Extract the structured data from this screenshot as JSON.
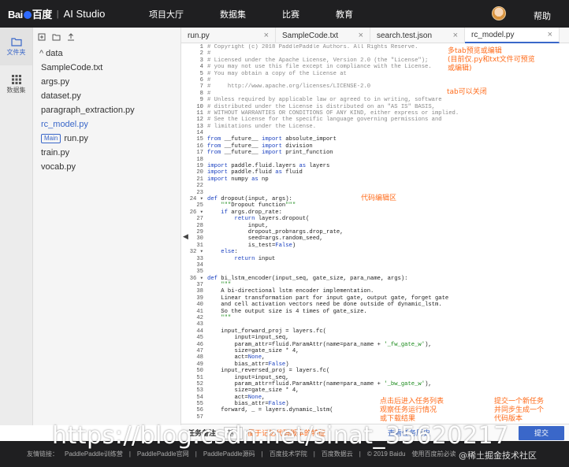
{
  "header": {
    "logo_text": "Bai百度",
    "title": "AI Studio",
    "nav": [
      "项目大厅",
      "数据集",
      "比赛",
      "教育"
    ],
    "help": "帮助"
  },
  "rail": {
    "items": [
      {
        "label": "文件夹",
        "icon": "folder-icon"
      },
      {
        "label": "数据集",
        "icon": "dataset-grid-icon"
      }
    ]
  },
  "filetree": {
    "folder": "data",
    "files": [
      "SampleCode.txt",
      "args.py",
      "dataset.py",
      "paragraph_extraction.py",
      "rc_model.py",
      "run.py",
      "train.py",
      "vocab.py"
    ],
    "main_badge": "Main",
    "selected": "rc_model.py"
  },
  "tabs": [
    {
      "label": "run.py"
    },
    {
      "label": "SampleCode.txt"
    },
    {
      "label": "search.test.json"
    },
    {
      "label": "rc_model.py"
    }
  ],
  "code": {
    "line_numbers": [
      "1",
      "2",
      "3",
      "4",
      "5",
      "6",
      "7",
      "8",
      "9",
      "10",
      "11",
      "12",
      "13",
      "14",
      "15",
      "16",
      "17",
      "18",
      "19",
      "20",
      "21",
      "22",
      "23",
      "24 ▾",
      "25",
      "26 ▾",
      "27",
      "28",
      "29",
      "30",
      "31",
      "32 ▾",
      "33",
      "34",
      "35",
      "36 ▾",
      "37",
      "38",
      "39",
      "40",
      "41",
      "42",
      "43",
      "44",
      "45",
      "46",
      "47",
      "48",
      "49",
      "50",
      "51",
      "52",
      "53",
      "54",
      "55",
      "56",
      "57"
    ],
    "lines": [
      "# Copyright (c) 2018 PaddlePaddle Authors. All Rights Reserve.",
      "#",
      "# Licensed under the Apache License, Version 2.0 (the \"License\");",
      "# you may not use this file except in compliance with the License.",
      "# You may obtain a copy of the License at",
      "#",
      "#     http://www.apache.org/licenses/LICENSE-2.0",
      "#",
      "# Unless required by applicable law or agreed to in writing, software",
      "# distributed under the License is distributed on an \"AS IS\" BASIS,",
      "# WITHOUT WARRANTIES OR CONDITIONS OF ANY KIND, either express or implied.",
      "# See the License for the specific language governing permissions and",
      "# limitations under the License.",
      "",
      "from __future__ import absolute_import",
      "from __future__ import division",
      "from __future__ import print_function",
      "",
      "import paddle.fluid.layers as layers",
      "import paddle.fluid as fluid",
      "import numpy as np",
      "",
      "",
      "def dropout(input, args):",
      "    \"\"\"Dropout function\"\"\"",
      "    if args.drop_rate:",
      "        return layers.dropout(",
      "            input,",
      "            dropout_prob=args.drop_rate,",
      "            seed=args.random_seed,",
      "            is_test=False)",
      "    else:",
      "        return input",
      "",
      "",
      "def bi_lstm_encoder(input_seq, gate_size, para_name, args):",
      "    \"\"\"",
      "    A bi-directional lstm encoder implementation.",
      "    Linear transformation part for input gate, output gate, forget gate",
      "    and cell activation vectors need be done outside of dynamic_lstm.",
      "    So the output size is 4 times of gate_size.",
      "    \"\"\"",
      "",
      "    input_forward_proj = layers.fc(",
      "        input=input_seq,",
      "        param_attr=fluid.ParamAttr(name=para_name + '_fw_gate_w'),",
      "        size=gate_size * 4,",
      "        act=None,",
      "        bias_attr=False)",
      "    input_reversed_proj = layers.fc(",
      "        input=input_seq,",
      "        param_attr=fluid.ParamAttr(name=para_name + '_bw_gate_w'),",
      "        size=gate_size * 4,",
      "        act=None,",
      "        bias_attr=False)",
      "    forward, _ = layers.dynamic_lstm(",
      ""
    ]
  },
  "annotations": {
    "tabs_note": [
      "多tab预览或编辑",
      "(目前仅.py和txt文件可预览",
      "或编辑)"
    ],
    "close_note": "tab可以关闭",
    "editor_note": "代码编辑区",
    "history_note": [
      "点击后进入任务列表",
      "观察任务运行情况",
      "或下载结果"
    ],
    "submit_note": [
      "提交一个新任务",
      "并同步生成一个",
      "代码版本"
    ]
  },
  "bottombar": {
    "label": "任务备注",
    "input_value": "基线",
    "hint": "便于记忆代码版本的特征",
    "history": "查看任务历史",
    "submit": "提交"
  },
  "footer": {
    "items": [
      "友情链接：",
      "PaddlePaddle训练营",
      "PaddlePaddle官网",
      "PaddlePaddle源码",
      "百度技术学院",
      "百度数据云",
      "© 2019 Baidu",
      "使用百度前必读",
      "@稀土掘金技术社区"
    ]
  },
  "watermark": "https://blog.csdn.net/sinat_35620217"
}
